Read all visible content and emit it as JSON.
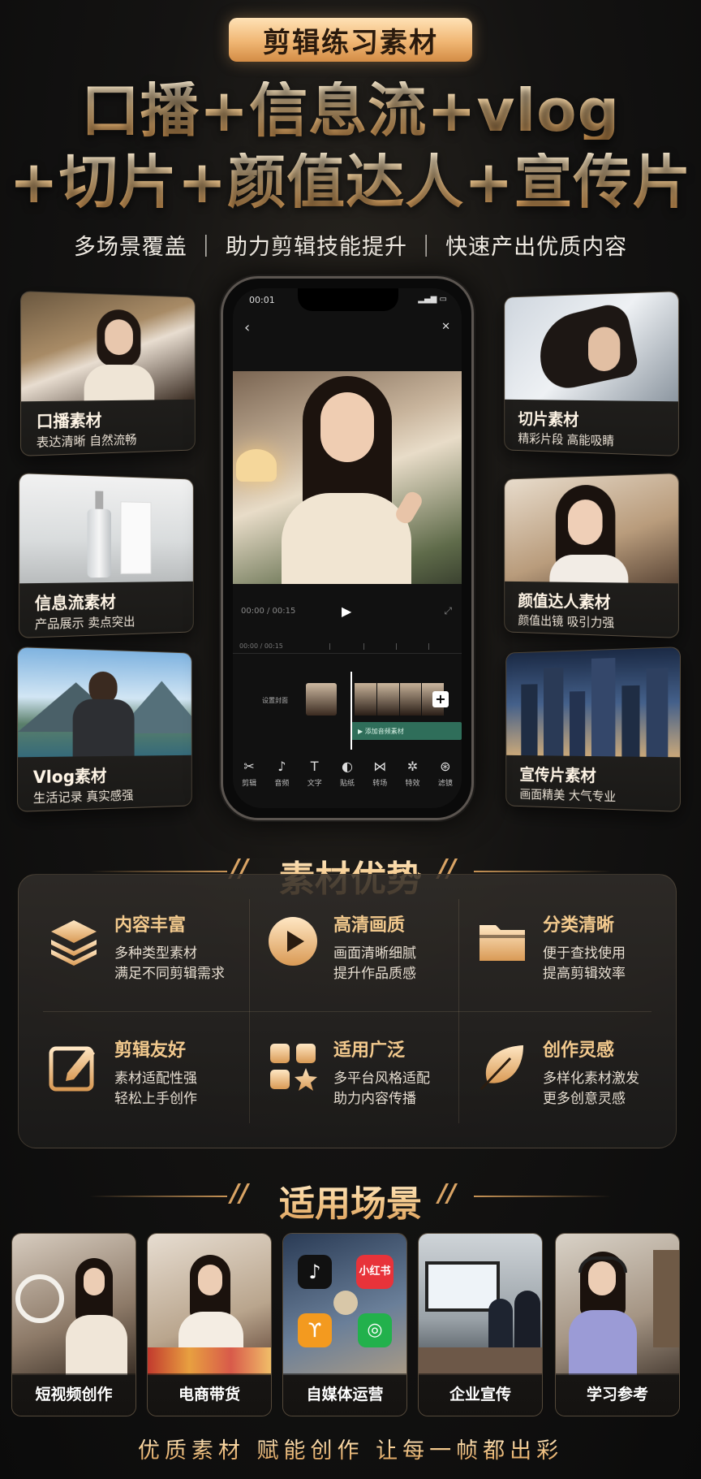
{
  "header": {
    "badge": "剪辑练习素材",
    "headline_line1": "口播+信息流+vlog",
    "headline_line2": "+切片+颜值达人+宣传片",
    "subline": "多场景覆盖 ｜ 助力剪辑技能提升 ｜ 快速产出优质内容"
  },
  "side_cards_left": [
    {
      "title": "口播素材",
      "desc": "表达清晰 自然流畅"
    },
    {
      "title": "信息流素材",
      "desc": "产品展示 卖点突出"
    },
    {
      "title": "Vlog素材",
      "desc": "生活记录 真实感强"
    }
  ],
  "side_cards_right": [
    {
      "title": "切片素材",
      "desc": "精彩片段 高能吸睛"
    },
    {
      "title": "颜值达人素材",
      "desc": "颜值出镜 吸引力强"
    },
    {
      "title": "宣传片素材",
      "desc": "画面精美 大气专业"
    }
  ],
  "phone": {
    "status_time": "00:01",
    "timecode": "00:00 / 00:15",
    "timeline_time": "00:00 / 00:15",
    "cover_label": "设置封面",
    "green_track_label": "▶ 添加音频素材",
    "toolbar": [
      {
        "icon": "scissors-icon",
        "label": "剪辑"
      },
      {
        "icon": "music-icon",
        "label": "音频"
      },
      {
        "icon": "text-icon",
        "label": "文字"
      },
      {
        "icon": "sticker-icon",
        "label": "贴纸"
      },
      {
        "icon": "transition-icon",
        "label": "转场"
      },
      {
        "icon": "effects-icon",
        "label": "特效"
      },
      {
        "icon": "filter-icon",
        "label": "滤镜"
      }
    ]
  },
  "advantages": {
    "title": "素材优势",
    "items": [
      {
        "icon": "layers-icon",
        "title": "内容丰富",
        "line1": "多种类型素材",
        "line2": "满足不同剪辑需求"
      },
      {
        "icon": "play-circle-icon",
        "title": "高清画质",
        "line1": "画面清晰细腻",
        "line2": "提升作品质感"
      },
      {
        "icon": "folder-icon",
        "title": "分类清晰",
        "line1": "便于查找使用",
        "line2": "提高剪辑效率"
      },
      {
        "icon": "edit-icon",
        "title": "剪辑友好",
        "line1": "素材适配性强",
        "line2": "轻松上手创作"
      },
      {
        "icon": "apps-star-icon",
        "title": "适用广泛",
        "line1": "多平台风格适配",
        "line2": "助力内容传播"
      },
      {
        "icon": "leaf-icon",
        "title": "创作灵感",
        "line1": "多样化素材激发",
        "line2": "更多创意灵感"
      }
    ]
  },
  "scenarios": {
    "title": "适用场景",
    "items": [
      {
        "label": "短视频创作"
      },
      {
        "label": "电商带货"
      },
      {
        "label": "自媒体运营",
        "app_label": "小红书"
      },
      {
        "label": "企业宣传"
      },
      {
        "label": "学习参考"
      }
    ]
  },
  "footer": "优质素材 赋能创作 让每一帧都出彩",
  "colors": {
    "accent": "#f2c98d",
    "badge_top": "#ffe2b6",
    "badge_bottom": "#d38c45",
    "background": "#141312"
  }
}
